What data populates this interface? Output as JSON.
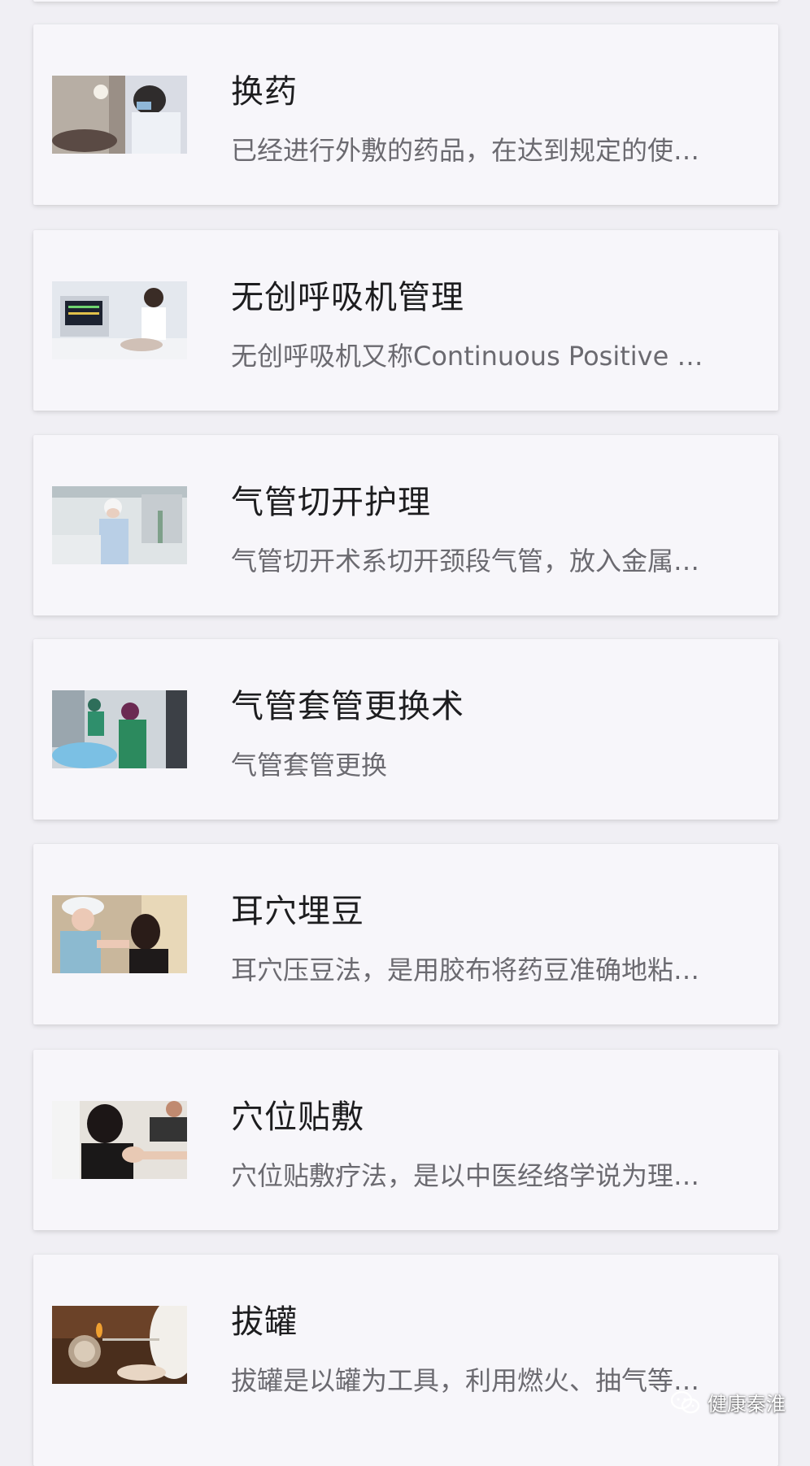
{
  "items": [
    {
      "title": "换药",
      "desc": "已经进行外敷的药品，在达到规定的使…",
      "image": "wound-dressing-change-photo"
    },
    {
      "title": "无创呼吸机管理",
      "desc": "无创呼吸机又称Continuous Positive …",
      "image": "noninvasive-ventilator-photo"
    },
    {
      "title": "气管切开护理",
      "desc": "气管切开术系切开颈段气管，放入金属…",
      "image": "tracheotomy-care-photo"
    },
    {
      "title": "气管套管更换术",
      "desc": "气管套管更换",
      "image": "tracheal-tube-replacement-photo"
    },
    {
      "title": "耳穴埋豆",
      "desc": "耳穴压豆法，是用胶布将药豆准确地粘…",
      "image": "ear-acupoint-seeds-photo"
    },
    {
      "title": "穴位贴敷",
      "desc": "穴位贴敷疗法，是以中医经络学说为理…",
      "image": "acupoint-application-photo"
    },
    {
      "title": "拔罐",
      "desc": "拔罐是以罐为工具，利用燃火、抽气等…",
      "image": "cupping-therapy-photo"
    }
  ],
  "watermark": {
    "text": "健康秦淮",
    "icon": "wechat-icon"
  },
  "colors": {
    "page_bg": "#f0eff4",
    "card_bg": "#f7f6fa",
    "title": "#1d1d1f",
    "desc": "#6b6a70"
  }
}
